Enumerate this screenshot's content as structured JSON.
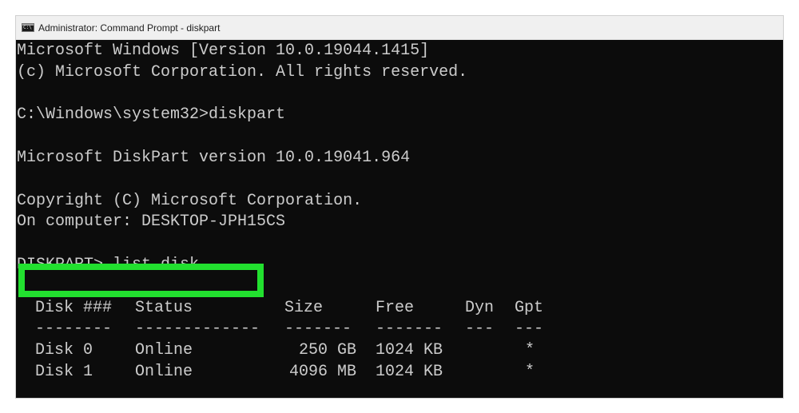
{
  "window": {
    "title": "Administrator: Command Prompt - diskpart",
    "icon": "cmd-icon"
  },
  "console": {
    "lines": [
      "Microsoft Windows [Version 10.0.19044.1415]",
      "(c) Microsoft Corporation. All rights reserved.",
      "",
      "C:\\Windows\\system32>diskpart",
      "",
      "Microsoft DiskPart version 10.0.19041.964",
      "",
      "Copyright (C) Microsoft Corporation.",
      "On computer: DESKTOP-JPH15CS",
      "",
      "DISKPART> list disk",
      ""
    ],
    "highlighted_command": "DISKPART> list disk",
    "highlight_color": "#22e02f",
    "text_color": "#cccccc",
    "background_color": "#0c0c0c"
  },
  "disk_table": {
    "headers": {
      "disk": "Disk ###",
      "status": "Status",
      "size": "Size",
      "free": "Free",
      "dyn": "Dyn",
      "gpt": "Gpt"
    },
    "separators": {
      "disk": "--------",
      "status": "-------------",
      "size": "-------",
      "free": "-------",
      "dyn": "---",
      "gpt": "---"
    },
    "rows": [
      {
        "disk": "Disk 0",
        "status": "Online",
        "size": "250 GB",
        "free": "1024 KB",
        "dyn": "",
        "gpt": "*"
      },
      {
        "disk": "Disk 1",
        "status": "Online",
        "size": "4096 MB",
        "free": "1024 KB",
        "dyn": "",
        "gpt": "*"
      }
    ]
  }
}
